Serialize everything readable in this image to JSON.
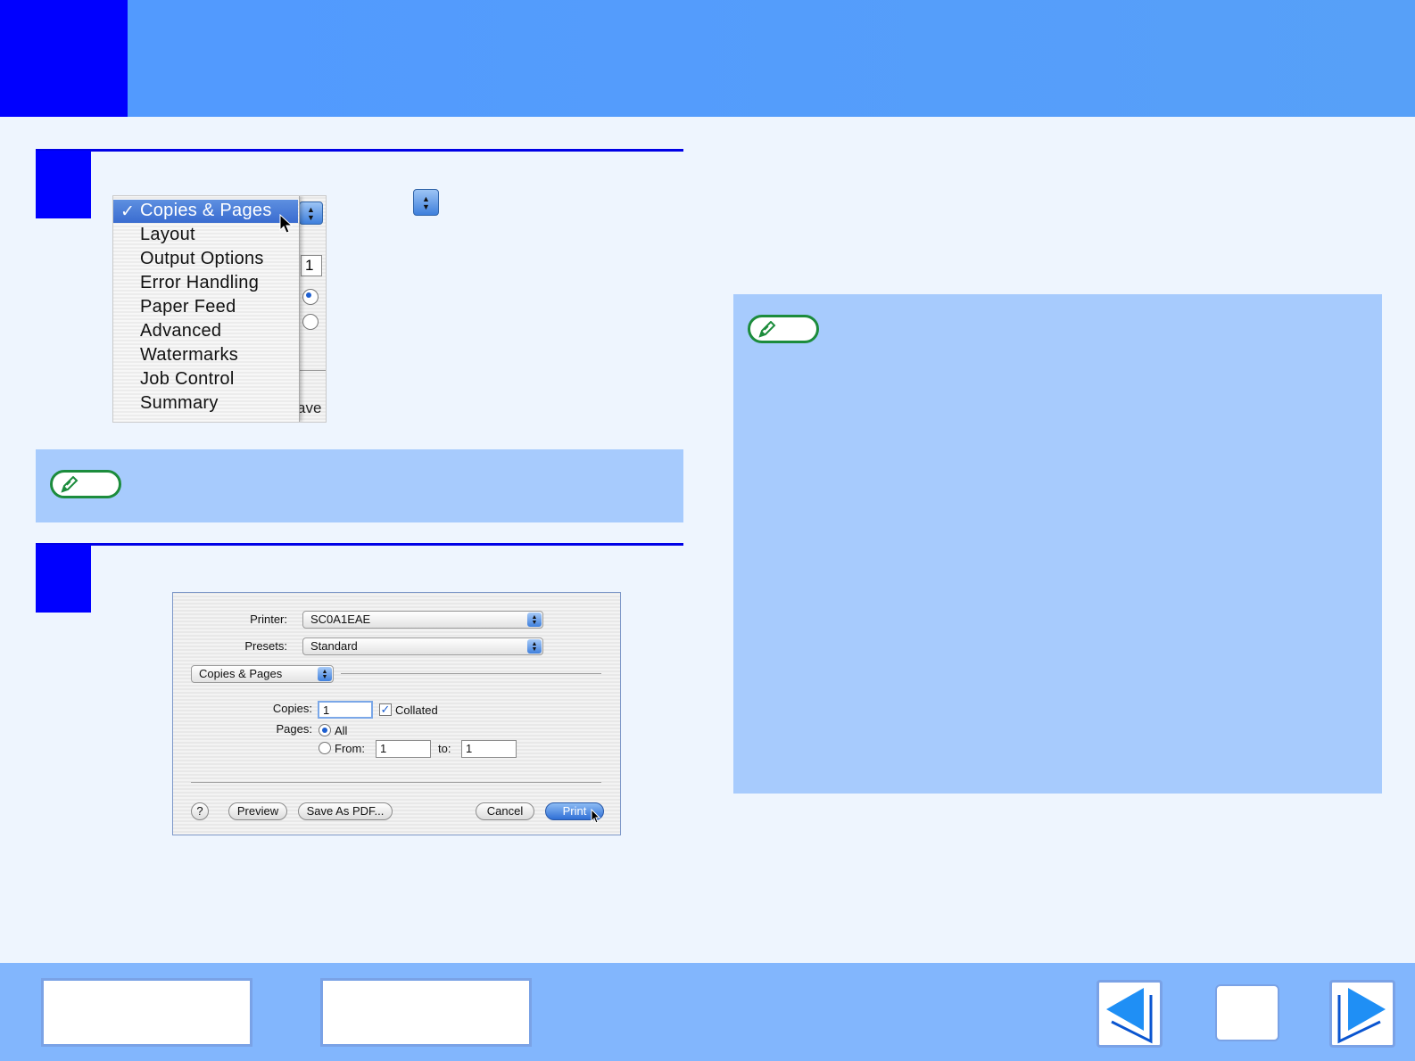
{
  "menu": {
    "items": [
      "Copies & Pages",
      "Layout",
      "Output Options",
      "Error Handling",
      "Paper Feed",
      "Advanced",
      "Watermarks",
      "Job Control",
      "Summary"
    ],
    "checkmark": "✓",
    "selected_index": 0,
    "background_copies": "1",
    "background_save": "ave"
  },
  "dialog": {
    "printer_label": "Printer:",
    "printer_value": "SC0A1EAE",
    "presets_label": "Presets:",
    "presets_value": "Standard",
    "panel_value": "Copies & Pages",
    "copies_label": "Copies:",
    "copies_value": "1",
    "collated_label": "Collated",
    "collated_checked": true,
    "pages_label": "Pages:",
    "all_label": "All",
    "from_label": "From:",
    "from_value": "1",
    "to_label": "to:",
    "to_value": "1",
    "help_label": "?",
    "preview_label": "Preview",
    "save_pdf_label": "Save As PDF...",
    "cancel_label": "Cancel",
    "print_label": "Print"
  },
  "icons": {
    "note": "pencil-icon",
    "prev": "left-arrow-icon",
    "next": "right-arrow-icon"
  },
  "colors": {
    "header": "#5199ff",
    "step_marker": "#0000ff",
    "note_panel": "#a7cbfd",
    "note_border": "#1c8c3c",
    "bottom_bar": "#82b6fd",
    "nav_arrow": "#1f8ff5"
  }
}
